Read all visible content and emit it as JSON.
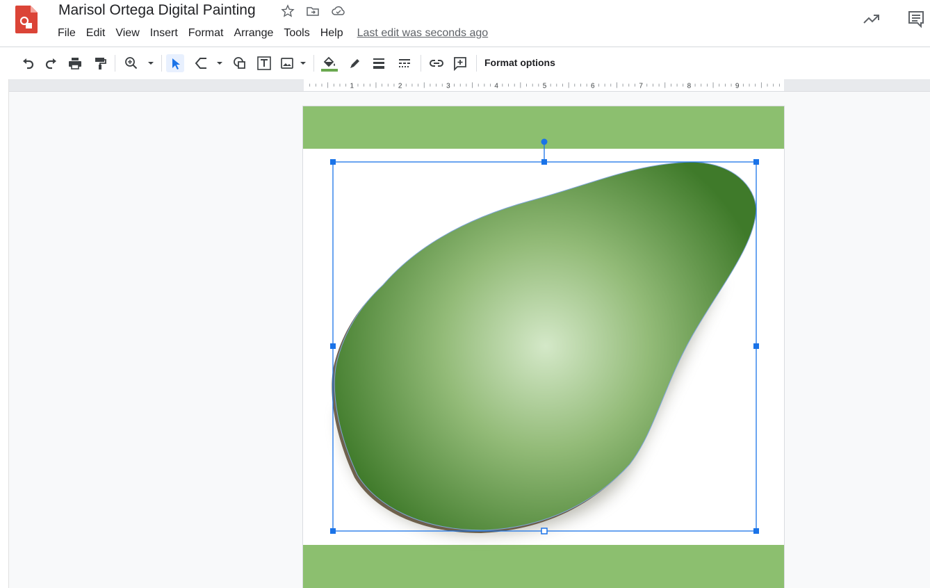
{
  "app": {
    "title": "Marisol Ortega Digital Painting",
    "icons": [
      "star-icon",
      "move-to-folder-icon",
      "cloud-status-icon"
    ]
  },
  "menu": {
    "items": [
      "File",
      "Edit",
      "View",
      "Insert",
      "Format",
      "Arrange",
      "Tools",
      "Help"
    ],
    "last_edit": "Last edit was seconds ago"
  },
  "header_right": {
    "icons": [
      "activity-trend-icon",
      "comments-icon"
    ]
  },
  "toolbar": {
    "icons": [
      "undo-icon",
      "redo-icon",
      "print-icon",
      "paint-format-icon",
      "zoom-icon",
      "select-icon",
      "line-icon",
      "shape-icon",
      "text-box-icon",
      "image-icon",
      "fill-color-icon",
      "border-color-icon",
      "border-weight-icon",
      "border-dash-icon",
      "link-icon",
      "add-comment-icon"
    ],
    "format_options": "Format options"
  },
  "ruler": {
    "labels": [
      "1",
      "2",
      "3",
      "4",
      "5",
      "6",
      "7",
      "8",
      "9"
    ]
  },
  "colors": {
    "brand_red": "#db4437",
    "selection_blue": "#1a73e8",
    "band_green": "#8cbf6f",
    "avocado_dark": "#3f7a2a",
    "avocado_light": "#d4e8c8"
  }
}
